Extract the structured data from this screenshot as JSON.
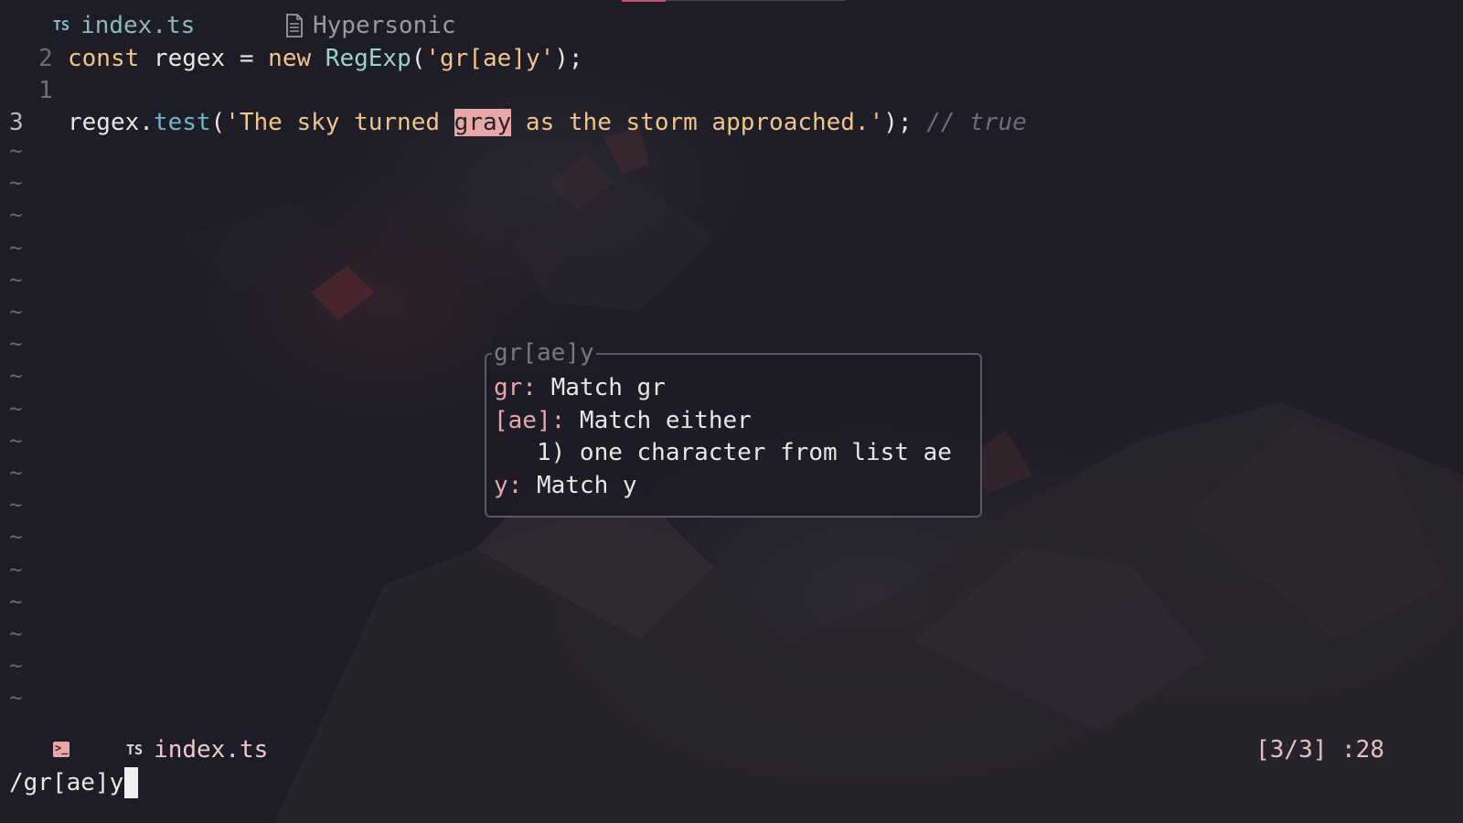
{
  "tabs": [
    {
      "badge": "TS",
      "label": "index.ts",
      "active": true
    },
    {
      "icon": "file-icon",
      "label": "Hypersonic",
      "active": false
    }
  ],
  "editor": {
    "lines": [
      {
        "number": "2",
        "parts": [
          {
            "text": "const",
            "cls": "kw"
          },
          {
            "text": " regex ",
            "cls": "plain"
          },
          {
            "text": "=",
            "cls": "plain"
          },
          {
            "text": " new ",
            "cls": "kw"
          },
          {
            "text": "RegExp",
            "cls": "fn"
          },
          {
            "text": "(",
            "cls": "plain"
          },
          {
            "text": "'gr[ae]y'",
            "cls": "str"
          },
          {
            "text": ");",
            "cls": "plain"
          }
        ]
      },
      {
        "number": "1",
        "parts": []
      },
      {
        "number": "3",
        "current": true,
        "parts": [
          {
            "text": "regex.",
            "cls": "plain"
          },
          {
            "text": "test",
            "cls": "method"
          },
          {
            "text": "(",
            "cls": "plain"
          },
          {
            "text": "'The sky turned ",
            "cls": "str"
          },
          {
            "text": "gray",
            "cls": "match"
          },
          {
            "text": " as the storm approached.'",
            "cls": "str"
          },
          {
            "text": "); ",
            "cls": "plain"
          },
          {
            "text": "// true",
            "cls": "comment"
          }
        ]
      }
    ],
    "tilde": "~",
    "tilde_count": 18
  },
  "popup": {
    "title": "gr[ae]y",
    "rows": [
      {
        "key": "gr:",
        "value": " Match gr"
      },
      {
        "key": "[ae]:",
        "value": " Match either"
      },
      {
        "key": "",
        "value": "   1) one character from list ae"
      },
      {
        "key": "y:",
        "value": " Match y"
      }
    ]
  },
  "statusline": {
    "terminal_icon": "terminal-icon",
    "badge": "TS",
    "filename": "index.ts",
    "position": "[3/3] :28"
  },
  "cmdline": {
    "text": "/gr[ae]y"
  },
  "colors": {
    "background": "#1d1d27",
    "match_highlight": "#e8a8a8",
    "keyword": "#f0c48a",
    "function": "#9ed0d0"
  }
}
